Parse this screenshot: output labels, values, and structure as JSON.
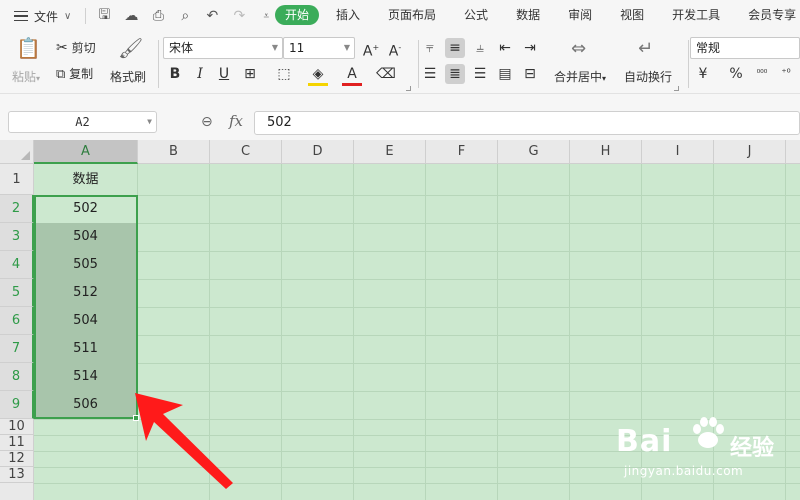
{
  "menubar": {
    "file_label": "文件",
    "tabs": [
      {
        "label": "开始",
        "active": true
      },
      {
        "label": "插入"
      },
      {
        "label": "页面布局"
      },
      {
        "label": "公式"
      },
      {
        "label": "数据"
      },
      {
        "label": "审阅"
      },
      {
        "label": "视图"
      },
      {
        "label": "开发工具"
      },
      {
        "label": "会员专享"
      }
    ]
  },
  "ribbon": {
    "paste_label": "粘贴",
    "cut_label": "剪切",
    "copy_label": "复制",
    "format_painter_label": "格式刷",
    "font_name": "宋体",
    "font_size": "11",
    "merge_label": "合并居中",
    "wrap_label": "自动换行",
    "number_format": "常规",
    "currency_symbol": "¥",
    "percent_symbol": "%"
  },
  "formula_bar": {
    "name_box": "A2",
    "fx_label": "fx",
    "formula_value": "502"
  },
  "grid": {
    "columns": [
      "A",
      "B",
      "C",
      "D",
      "E",
      "F",
      "G",
      "H",
      "I",
      "J"
    ],
    "rows": [
      "1",
      "2",
      "3",
      "4",
      "5",
      "6",
      "7",
      "8",
      "9",
      "10",
      "11",
      "12",
      "13"
    ],
    "cells": {
      "A1": "数据",
      "A2": "502",
      "A3": "504",
      "A4": "505",
      "A5": "512",
      "A6": "504",
      "A7": "511",
      "A8": "514",
      "A9": "506"
    },
    "selected_range": "A2:A9",
    "active_cell": "A2"
  },
  "watermark": {
    "logo_text": "Bai",
    "logo_cn": "经验",
    "url": "jingyan.baidu.com"
  },
  "colors": {
    "accent": "#3bac5a",
    "sheet_background": "#cce8cf",
    "selection_fill": "#a8c5ab",
    "annotation_arrow": "#ff1a1a"
  }
}
